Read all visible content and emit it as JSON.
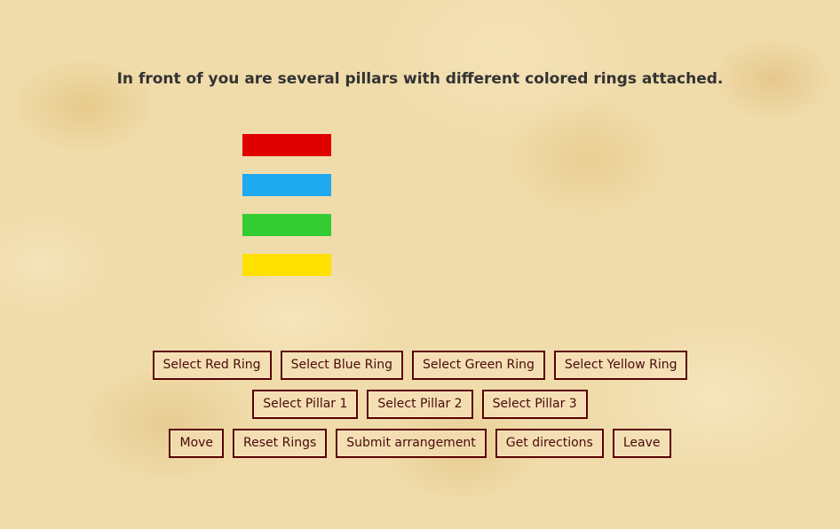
{
  "heading": "In front of you are several pillars with different colored rings attached.",
  "pillar_1": {
    "rings": [
      {
        "color": "#e00000",
        "name": "red"
      },
      {
        "color": "#1fa9ef",
        "name": "blue"
      },
      {
        "color": "#33cc33",
        "name": "green"
      },
      {
        "color": "#ffe000",
        "name": "yellow"
      }
    ]
  },
  "buttons": {
    "select_red_ring": "Select Red Ring",
    "select_blue_ring": "Select Blue Ring",
    "select_green_ring": "Select Green Ring",
    "select_yellow_ring": "Select Yellow Ring",
    "select_pillar_1": "Select Pillar 1",
    "select_pillar_2": "Select Pillar 2",
    "select_pillar_3": "Select Pillar 3",
    "move": "Move",
    "reset_rings": "Reset Rings",
    "submit_arrangement": "Submit arrangement",
    "get_directions": "Get directions",
    "leave": "Leave"
  },
  "colors": {
    "button_border": "#5a0000",
    "button_text": "#4a0a0a",
    "heading_text": "#333333",
    "background": "#f0dcab"
  }
}
